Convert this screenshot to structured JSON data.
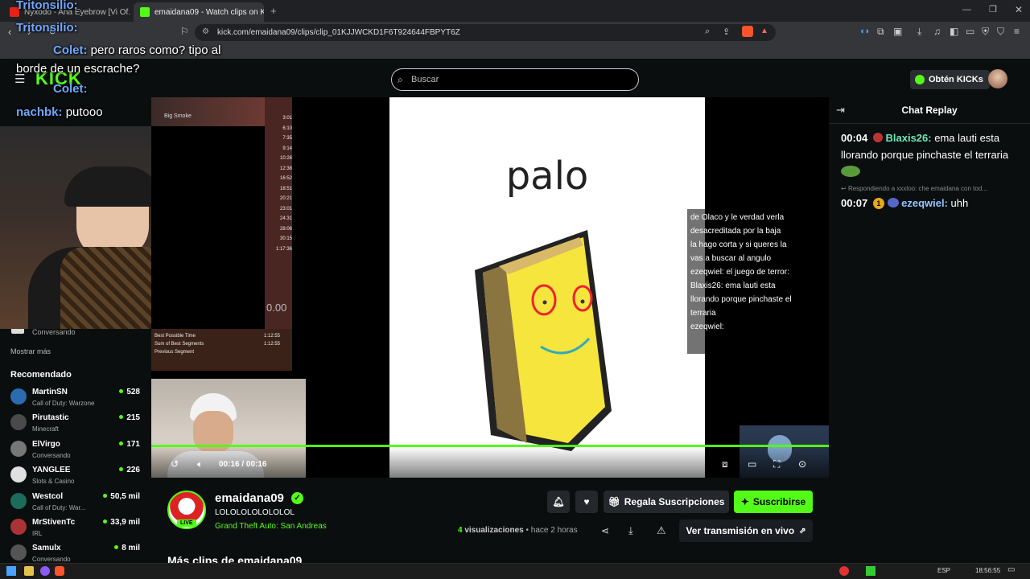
{
  "browser": {
    "tabs": [
      {
        "label": "Nyxodo - Ana Eyebrow [Vi Of..."
      },
      {
        "label": "emaidana09 - Watch clips on Ki"
      }
    ],
    "url": "kick.com/emaidana09/clips/clip_01KJJWCKD1F6T924644FBPYT6Z"
  },
  "header": {
    "logo": "KICK",
    "search_placeholder": "Buscar",
    "kicks_label": "Obtén KICKs"
  },
  "stream_overlay_chat": [
    {
      "user": "Tritonsilio:",
      "text": ""
    },
    {
      "user": "Tritonsilio:",
      "text": ""
    },
    {
      "user": "Colet:",
      "text": "pero raros como? tipo al"
    },
    {
      "user": "",
      "text": "borde de un escrache?"
    },
    {
      "user": "Colet:",
      "text": ""
    },
    {
      "user": "nachbk:",
      "text": "putooo"
    }
  ],
  "sidebar": {
    "top_item_category": "Conversando",
    "show_more": "Mostrar más",
    "recommended_title": "Recomendado",
    "channels": [
      {
        "name": "MartinSN",
        "category": "Call of Duty: Warzone",
        "viewers": "528",
        "color": "#2b6cb0"
      },
      {
        "name": "Pirutastic",
        "category": "Minecraft",
        "viewers": "215",
        "color": "#444"
      },
      {
        "name": "ElVirgo",
        "category": "Conversando",
        "viewers": "171",
        "color": "#777"
      },
      {
        "name": "YANGLEE",
        "category": "Slots & Casino",
        "viewers": "226",
        "color": "#e0e0e0"
      },
      {
        "name": "Westcol",
        "category": "Call of Duty: War...",
        "viewers": "50,5 mil",
        "color": "#1d6b5a"
      },
      {
        "name": "MrStivenTc",
        "category": "IRL",
        "viewers": "33,9 mil",
        "color": "#a33"
      },
      {
        "name": "Samulx",
        "category": "Conversando",
        "viewers": "8 mil",
        "color": "#555"
      }
    ]
  },
  "video": {
    "slide_word": "palo",
    "time": "00:16 / 00:16",
    "progress": 1.0,
    "split_label": "Big Smoke",
    "split_times": [
      "3:01",
      "6:10",
      "7:35",
      "9:14",
      "10:26",
      "12:38",
      "16:52",
      "18:51",
      "20:21",
      "23:01",
      "24:31",
      "28:06",
      "30:15",
      "1:17:36"
    ],
    "split_timer": "0.00",
    "split_footer": [
      "Best Possible Time",
      "Sum of Best Segments",
      "Previous Segment"
    ],
    "split_footer_vals": [
      "1:12:55",
      "1:12:55",
      ""
    ],
    "overlay_chat_lines": [
      "de Olaco y le verdad verla",
      "desacreditada por     la baja",
      "     la hago corta y si queres la",
      "vas a buscar al angulo",
      "ezeqwiel: el juego de terror:",
      "",
      "Blaxis26: ema lauti esta",
      "llorando porque pinchaste el",
      "terraria",
      "ezeqwiel:"
    ]
  },
  "chat": {
    "title": "Chat Replay",
    "messages": [
      {
        "time": "00:04",
        "user": "Blaxis26:",
        "user_color": "#6ee7b7",
        "text": "ema lauti esta llorando porque pinchaste el terraria"
      },
      {
        "reply": "Respondiendo a xxxloo: che emaidana con tod..."
      },
      {
        "time": "00:07",
        "user": "ezeqwiel:",
        "user_color": "#93c5fd",
        "text": "uhh",
        "badge": "1"
      }
    ]
  },
  "channel": {
    "name": "emaidana09",
    "clip_title": "LOLOLOLOLOLOLOL",
    "game": "Grand Theft Auto: San Andreas",
    "live_badge": "LIVE",
    "views_count": "4",
    "views_label": "visualizaciones",
    "age": "• hace 2 horas",
    "gift_label": "Regala Suscripciones",
    "subscribe_label": "Suscribirse",
    "watch_live_label": "Ver transmisión en vivo",
    "more_clips": "Más clips de emaidana09"
  },
  "taskbar": {
    "lang": "ESP",
    "clock": "18:56:55"
  },
  "colors": {
    "kick_green": "#53fc18",
    "bg": "#0b0e0f"
  }
}
